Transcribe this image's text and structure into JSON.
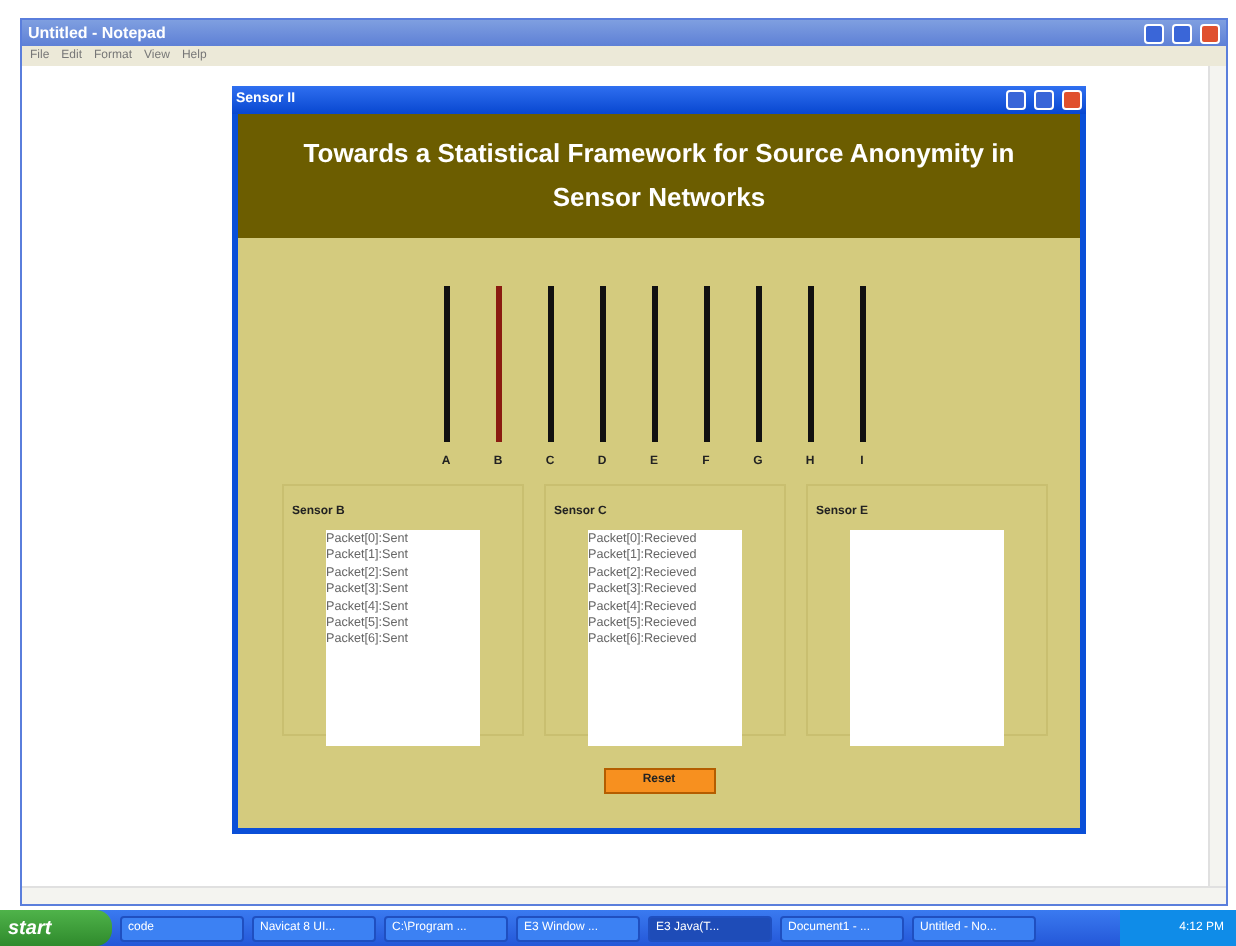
{
  "notepad": {
    "title": "Untitled - Notepad",
    "menu": [
      "File",
      "Edit",
      "Format",
      "View",
      "Help"
    ]
  },
  "sensor_window": {
    "title": "Sensor II",
    "heading": "Towards a Statistical Framework for Source Anonymity in Sensor Networks"
  },
  "sensors": [
    {
      "label": "A",
      "active": false
    },
    {
      "label": "B",
      "active": true
    },
    {
      "label": "C",
      "active": false
    },
    {
      "label": "D",
      "active": false
    },
    {
      "label": "E",
      "active": false
    },
    {
      "label": "F",
      "active": false
    },
    {
      "label": "G",
      "active": false
    },
    {
      "label": "H",
      "active": false
    },
    {
      "label": "I",
      "active": false
    }
  ],
  "panels": [
    {
      "title": "Sensor B",
      "items": [
        "Packet[0]:Sent",
        "Packet[1]:Sent",
        "Packet[2]:Sent",
        "Packet[3]:Sent",
        "Packet[4]:Sent",
        "Packet[5]:Sent",
        "Packet[6]:Sent"
      ]
    },
    {
      "title": "Sensor C",
      "items": [
        "Packet[0]:Recieved",
        "Packet[1]:Recieved",
        "Packet[2]:Recieved",
        "Packet[3]:Recieved",
        "Packet[4]:Recieved",
        "Packet[5]:Recieved",
        "Packet[6]:Recieved"
      ]
    },
    {
      "title": "Sensor E"
    }
  ],
  "reset_button": "Reset",
  "taskbar": {
    "start": "start",
    "items": [
      {
        "label": "code",
        "selected": false
      },
      {
        "label": "Navicat 8 UI...",
        "selected": false
      },
      {
        "label": "C:\\Program ...",
        "selected": false
      },
      {
        "label": "E3 Window ...",
        "selected": false
      },
      {
        "label": "E3 Java(T...",
        "selected": true
      },
      {
        "label": "Document1 - ...",
        "selected": false
      },
      {
        "label": "Untitled - No...",
        "selected": false
      }
    ],
    "clock": "4:12 PM"
  }
}
